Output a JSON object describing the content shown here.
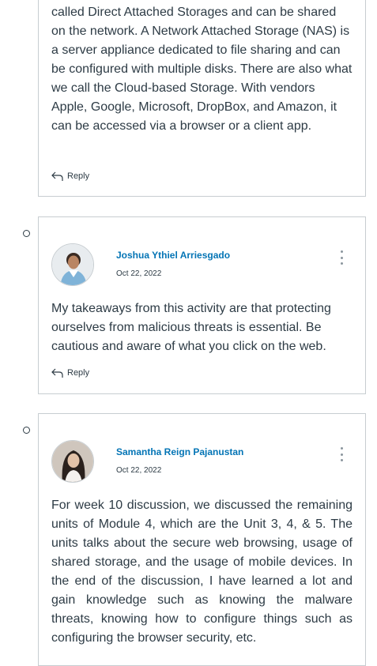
{
  "post1": {
    "body": "called Direct Attached Storages and can be shared on the network. A Network Attached Storage (NAS) is a server appliance dedicated to file sharing and can be configured with multiple disks. There are also what we call the Cloud-based Storage. With vendors Apple, Google, Microsoft, DropBox, and Amazon, it can be accessed via a browser or a client app.",
    "reply_label": "Reply"
  },
  "post2": {
    "author": "Joshua Ythiel Arriesgado",
    "date": "Oct 22, 2022",
    "body": "My takeaways from this activity are that protecting ourselves from malicious threats is essential. Be cautious and aware of what you click on the web.",
    "reply_label": "Reply"
  },
  "post3": {
    "author": "Samantha Reign Pajanustan",
    "date": "Oct 22, 2022",
    "body": "For week 10 discussion, we discussed the remaining units of Module 4, which are the Unit 3, 4, & 5. The units talks about the secure web browsing, usage of shared storage, and the usage of mobile devices. In the end of the discussion, I have learned a lot and gain knowledge such as knowing the malware threats, knowing how to configure things such as configuring the browser security, etc."
  },
  "colors": {
    "link": "#0374b5",
    "text": "#2d3b45",
    "border": "#c7cdd1"
  },
  "icons": {
    "reply": "reply-arrow-icon",
    "menu": "kebab-menu-icon"
  }
}
